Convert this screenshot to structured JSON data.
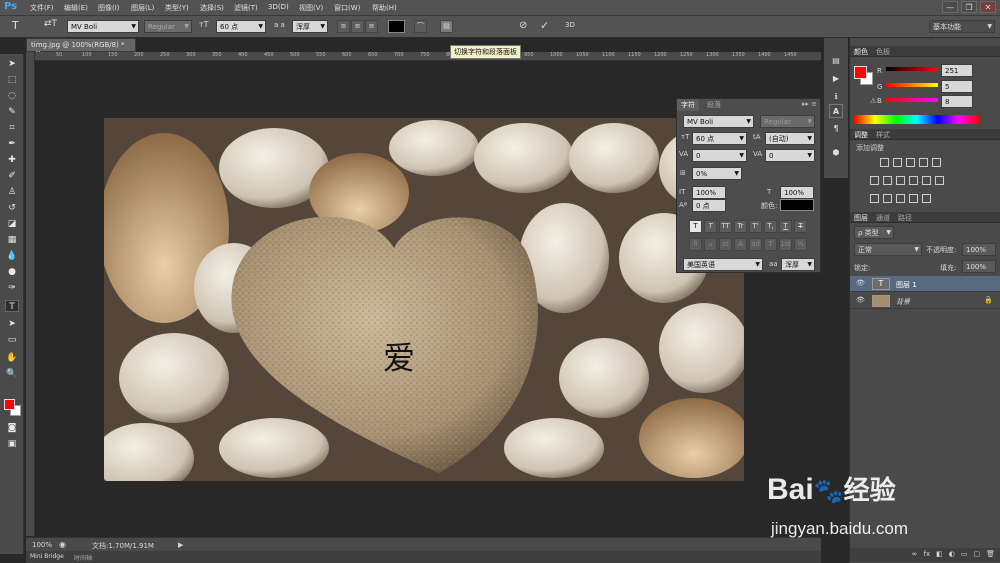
{
  "app": {
    "logo": "Ps",
    "menus": [
      "文件(F)",
      "编辑(E)",
      "图像(I)",
      "图层(L)",
      "类型(Y)",
      "选择(S)",
      "滤镜(T)",
      "3D(D)",
      "视图(V)",
      "窗口(W)",
      "帮助(H)"
    ],
    "window_controls": [
      "—",
      "❐",
      "✕"
    ]
  },
  "options": {
    "font_family": "MV Boli",
    "font_style": "Regular",
    "font_size": "60 点",
    "antialias_label": "a a",
    "antialias": "浑厚",
    "workspace": "基本功能",
    "color_swatch": "#000000"
  },
  "tooltip": "切换字符和段落面板",
  "document": {
    "tab": "timg.jpg @ 100%(RGB/8) *",
    "close": "×",
    "zoom": "100%",
    "doc_info": "文档:1.70M/1.91M",
    "text_layer_content": "爱"
  },
  "ruler_ticks": [
    "50",
    "100",
    "150",
    "200",
    "250",
    "300",
    "350",
    "400",
    "450",
    "500",
    "550",
    "600",
    "650",
    "700",
    "750",
    "800",
    "850",
    "900",
    "950",
    "1000",
    "1050",
    "1100",
    "1150",
    "1200",
    "1250",
    "1300",
    "1350",
    "1400",
    "1450",
    "1500"
  ],
  "bottom_tabs": [
    "Mini Bridge",
    "时间轴"
  ],
  "char_panel": {
    "tabs": [
      "字符",
      "段落"
    ],
    "font_family": "MV Boli",
    "font_style": "Regular",
    "size": "60 点",
    "leading": "(自动)",
    "kerning": "0",
    "tracking": "0",
    "tsume": "0%",
    "vscale": "100%",
    "hscale": "100%",
    "baseline": "0 点",
    "color_label": "颜色:",
    "color": "#000000",
    "style_buttons": [
      "T",
      "T",
      "TT",
      "Tr",
      "T'",
      "T,",
      "T",
      "T"
    ],
    "opentype_buttons": [
      "fi",
      "ℴ",
      "st",
      "A",
      "ad",
      "T",
      "1st",
      "½"
    ],
    "language": "美国英语",
    "aa_icon": "aa",
    "antialias": "浑厚"
  },
  "color_panel": {
    "tabs": [
      "颜色",
      "色板"
    ],
    "r_label": "R",
    "g_label": "G",
    "b_label": "B",
    "r": "251",
    "g": "5",
    "b": "8",
    "fg": "#fb0508"
  },
  "adjust_panel": {
    "tabs": [
      "调整",
      "样式"
    ],
    "title": "添加调整"
  },
  "layers_panel": {
    "tabs": [
      "图层",
      "通道",
      "路径"
    ],
    "kind": "类型",
    "blend": "正常",
    "opacity_label": "不透明度:",
    "opacity": "100%",
    "lock_label": "锁定:",
    "fill_label": "填充:",
    "fill": "100%",
    "layers": [
      {
        "name": "图层 1",
        "type": "text"
      },
      {
        "name": "背景",
        "type": "image"
      }
    ]
  },
  "watermark": {
    "brand": "Bai",
    "brand2": "经验",
    "url": "jingyan.baidu.com"
  }
}
